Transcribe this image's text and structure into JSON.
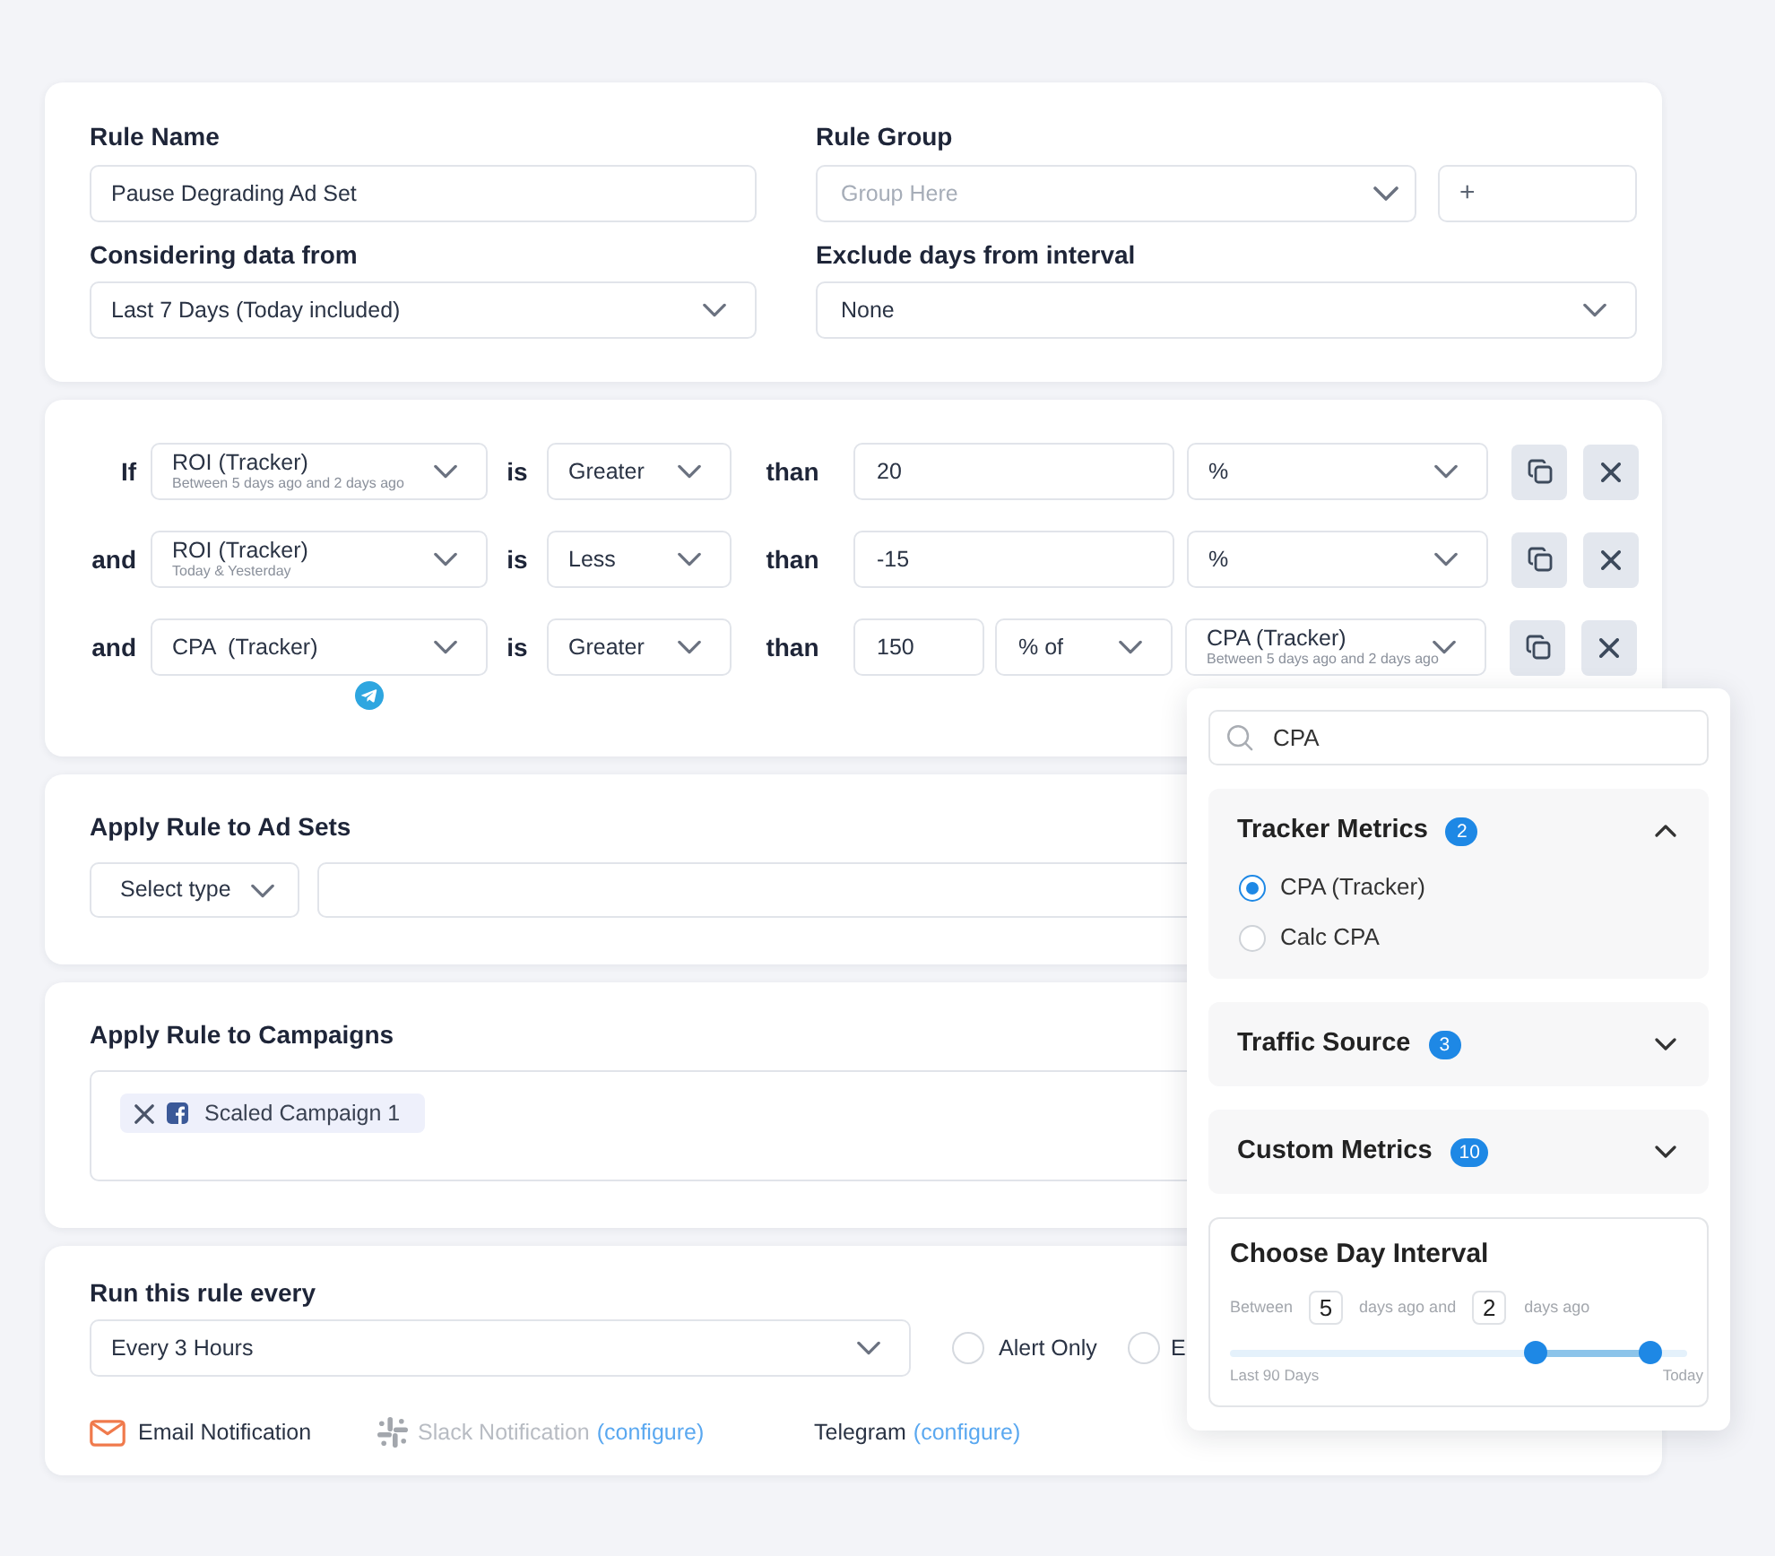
{
  "rule_settings": {
    "rule_name": {
      "label": "Rule Name",
      "value": "Pause Degrading Ad Set"
    },
    "rule_group": {
      "label": "Rule Group",
      "placeholder": "Group Here",
      "add_button": "+"
    },
    "data_range": {
      "label": "Considering data from",
      "value": "Last 7 Days (Today included)"
    },
    "exclude_days": {
      "label": "Exclude days from interval",
      "value": "None"
    }
  },
  "conditions": [
    {
      "kind": "absolute",
      "connector": "If",
      "metric": {
        "name": "ROI (Tracker)",
        "subtitle": "Between 5 days ago and 2 days ago"
      },
      "verb": "is",
      "operator": "Greater",
      "comparator": "than",
      "value": "20",
      "unit": {
        "name": "%"
      },
      "alert_icon": false
    },
    {
      "kind": "absolute",
      "connector": "and",
      "metric": {
        "name": "ROI (Tracker)",
        "subtitle": "Today & Yesterday"
      },
      "verb": "is",
      "operator": "Less",
      "comparator": "than",
      "value": "-15",
      "unit": {
        "name": "%"
      },
      "alert_icon": false
    },
    {
      "kind": "relative",
      "connector": "and",
      "metric": {
        "name": "CPA  (Tracker)"
      },
      "verb": "is",
      "operator": "Greater",
      "comparator": "than",
      "value": "150",
      "relation": "% of",
      "unit": {
        "name": "CPA (Tracker)",
        "subtitle": "Between 5 days ago and 2 days ago"
      },
      "alert_icon": true
    }
  ],
  "ad_sets": {
    "title": "Apply Rule to Ad Sets",
    "type_select": "Select type"
  },
  "campaigns": {
    "title": "Apply Rule to Campaigns",
    "tags": [
      {
        "label": "Scaled Campaign 1"
      }
    ]
  },
  "schedule": {
    "title": "Run this rule every",
    "value": "Every 3 Hours",
    "options": [
      {
        "label": "Alert Only",
        "selected": false
      },
      {
        "label": "E",
        "selected": false
      }
    ]
  },
  "notifications": [
    {
      "kind": "email",
      "label": "Email Notification",
      "disabled": false
    },
    {
      "kind": "slack",
      "label": "Slack Notification",
      "link": "(configure)",
      "disabled": true
    },
    {
      "kind": "telegram",
      "label": "Telegram",
      "link": "(configure)",
      "disabled": false
    }
  ],
  "metric_dropdown": {
    "search": {
      "value": "CPA"
    },
    "groups": [
      {
        "title": "Tracker Metrics",
        "count": "2",
        "expanded": true,
        "options": [
          {
            "label": "CPA (Tracker)",
            "selected": true
          },
          {
            "label": "Calc CPA",
            "selected": false
          }
        ]
      },
      {
        "title": "Traffic Source",
        "count": "3",
        "expanded": false
      },
      {
        "title": "Custom Metrics",
        "count": "10",
        "expanded": false
      }
    ],
    "day_interval": {
      "title": "Choose Day Interval",
      "prefix": "Between",
      "start_days": "5",
      "middle": "days ago and",
      "end_days": "2",
      "suffix": "days ago",
      "min_label": "Last 90 Days",
      "max_label": "Today",
      "handles": [
        {
          "level": 0.67
        },
        {
          "level": 0.92
        }
      ]
    }
  }
}
